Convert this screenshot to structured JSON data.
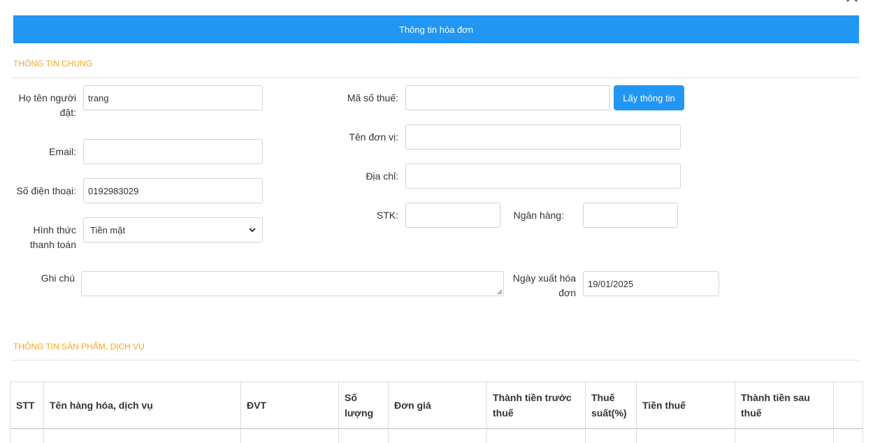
{
  "dialog": {
    "title": "Thông tin hóa đơn"
  },
  "sections": {
    "general": "THÔNG TIN CHUNG",
    "products": "THÔNG TIN SẢN PHẨM, DỊCH VỤ"
  },
  "form": {
    "name_label_1": "Họ tên người",
    "name_label_2": "đặt:",
    "name_value": "trang",
    "email_label": "Email:",
    "email_value": "",
    "phone_label": "Số điện thoại:",
    "phone_value": "0192983029",
    "payment_label_1": "Hình thức",
    "payment_label_2": "thanh toán",
    "payment_value": "Tiền mặt",
    "tax_label": "Mã số thuế:",
    "tax_value": "",
    "get_info_button": "Lấy thông tin",
    "unit_label": "Tên đơn vị:",
    "unit_value": "",
    "address_label": "Địa chỉ:",
    "address_value": "",
    "account_label": "STK:",
    "account_value": "",
    "bank_label": "Ngân hàng:",
    "bank_value": "",
    "note_label": "Ghi chú",
    "note_value": "",
    "date_label_1": "Ngày xuất hóa",
    "date_label_2": "đơn",
    "date_value": "19/01/2025"
  },
  "table": {
    "headers": [
      {
        "line1": "STT"
      },
      {
        "line1": "Tên hàng hóa, dịch vụ"
      },
      {
        "line1": "ĐVT"
      },
      {
        "line1": "Số",
        "line2": "lượng"
      },
      {
        "line1": "Đơn giá"
      },
      {
        "line1": "Thành tiền trước",
        "line2": "thuế"
      },
      {
        "line1": "Thuế",
        "line2": "suất(%)"
      },
      {
        "line1": "Tiền thuế"
      },
      {
        "line1": "Thành tiền sau thuế"
      },
      {
        "line1": ""
      }
    ]
  },
  "colors": {
    "primary": "#2196f3",
    "section_title": "#f5a623"
  },
  "icons": {
    "close": "close-icon",
    "select_arrow": "chevron-down-icon"
  }
}
